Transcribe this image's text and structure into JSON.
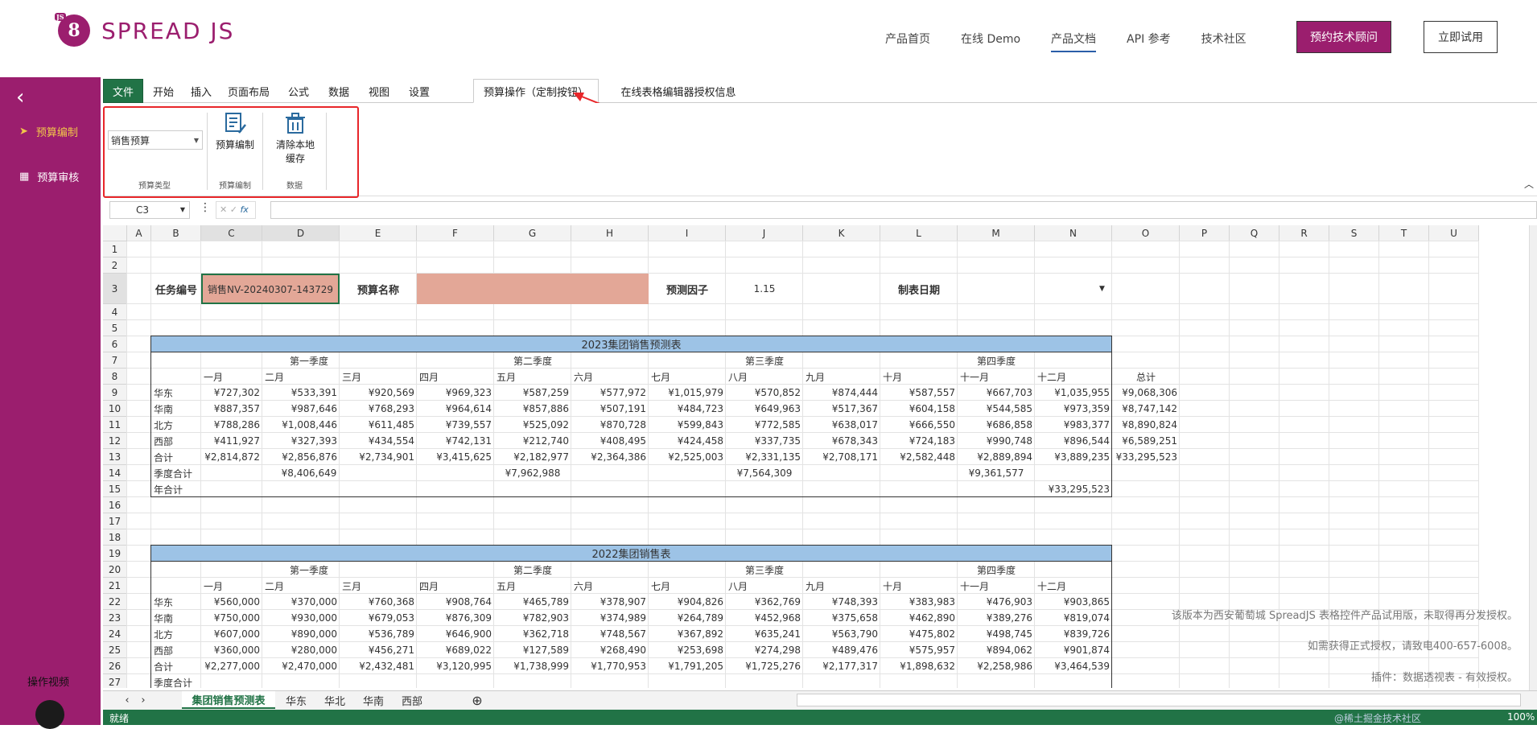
{
  "nav": {
    "logo_badge": "JS",
    "logo_letter": "8",
    "logo_text": "SPREAD JS",
    "links": [
      "产品首页",
      "在线 Demo",
      "产品文档",
      "API 参考",
      "技术社区"
    ],
    "active_link": "产品文档",
    "consult_button": "预约技术顾问",
    "try_button": "立即试用"
  },
  "sidebar": {
    "back_icon": "chevron-left-icon",
    "items": [
      {
        "label": "预算编制",
        "icon": "send-icon",
        "active": true
      },
      {
        "label": "预算审核",
        "icon": "grid-icon",
        "active": false
      }
    ],
    "video_label": "操作视频",
    "github_icon": "github-icon"
  },
  "ribbon": {
    "tabs": [
      "文件",
      "开始",
      "插入",
      "页面布局",
      "公式",
      "数据",
      "视图",
      "设置",
      "预算操作（定制按钮）",
      "在线表格编辑器授权信息"
    ],
    "active_tab": "预算操作（定制按钮）",
    "budget_type_value": "销售预算",
    "budget_type_group": "预算类型",
    "edit_button": "预算编制",
    "edit_group": "预算编制",
    "clear_button_line1": "清除本地",
    "clear_button_line2": "缓存",
    "clear_group": "数据"
  },
  "formula_bar": {
    "name_box": "C3",
    "fx_label": "fx",
    "fx_marks": "✕ ✓",
    "formula_value": ""
  },
  "columns": [
    "A",
    "B",
    "C",
    "D",
    "E",
    "F",
    "G",
    "H",
    "I",
    "J",
    "K",
    "L",
    "M",
    "N",
    "O",
    "P",
    "Q",
    "R",
    "S",
    "T",
    "U"
  ],
  "rows": [
    "1",
    "2",
    "3",
    "4",
    "5",
    "6",
    "7",
    "8",
    "9",
    "10",
    "11",
    "12",
    "13",
    "14",
    "15",
    "16",
    "17",
    "18",
    "19",
    "20",
    "21",
    "22",
    "23",
    "24",
    "25",
    "26",
    "27"
  ],
  "header_form": {
    "task_label": "任务编号",
    "task_value": "销售NV-20240307-143729",
    "name_label": "预算名称",
    "name_value": "",
    "factor_label": "预测因子",
    "factor_value": "1.15",
    "date_label": "制表日期",
    "date_value": ""
  },
  "table2023": {
    "title": "2023集团销售预测表",
    "quarters": [
      "第一季度",
      "第二季度",
      "第三季度",
      "第四季度"
    ],
    "months": [
      "一月",
      "二月",
      "三月",
      "四月",
      "五月",
      "六月",
      "七月",
      "八月",
      "九月",
      "十月",
      "十一月",
      "十二月"
    ],
    "total_header": "总计",
    "rows": [
      {
        "label": "华东",
        "values": [
          "¥727,302",
          "¥533,391",
          "¥920,569",
          "¥969,323",
          "¥587,259",
          "¥577,972",
          "¥1,015,979",
          "¥570,852",
          "¥874,444",
          "¥587,557",
          "¥667,703",
          "¥1,035,955"
        ],
        "total": "¥9,068,306"
      },
      {
        "label": "华南",
        "values": [
          "¥887,357",
          "¥987,646",
          "¥768,293",
          "¥964,614",
          "¥857,886",
          "¥507,191",
          "¥484,723",
          "¥649,963",
          "¥517,367",
          "¥604,158",
          "¥544,585",
          "¥973,359"
        ],
        "total": "¥8,747,142"
      },
      {
        "label": "北方",
        "values": [
          "¥788,286",
          "¥1,008,446",
          "¥611,485",
          "¥739,557",
          "¥525,092",
          "¥870,728",
          "¥599,843",
          "¥772,585",
          "¥638,017",
          "¥666,550",
          "¥686,858",
          "¥983,377"
        ],
        "total": "¥8,890,824"
      },
      {
        "label": "西部",
        "values": [
          "¥411,927",
          "¥327,393",
          "¥434,554",
          "¥742,131",
          "¥212,740",
          "¥408,495",
          "¥424,458",
          "¥337,735",
          "¥678,343",
          "¥724,183",
          "¥990,748",
          "¥896,544"
        ],
        "total": "¥6,589,251"
      },
      {
        "label": "合计",
        "values": [
          "¥2,814,872",
          "¥2,856,876",
          "¥2,734,901",
          "¥3,415,625",
          "¥2,182,977",
          "¥2,364,386",
          "¥2,525,003",
          "¥2,331,135",
          "¥2,708,171",
          "¥2,582,448",
          "¥2,889,894",
          "¥3,889,235"
        ],
        "total": "¥33,295,523"
      }
    ],
    "quarter_total_label": "季度合计",
    "quarter_totals": [
      "¥8,406,649",
      "¥7,962,988",
      "¥7,564,309",
      "¥9,361,577"
    ],
    "year_total_label": "年合计",
    "year_total": "¥33,295,523"
  },
  "table2022": {
    "title": "2022集团销售表",
    "quarters": [
      "第一季度",
      "第二季度",
      "第三季度",
      "第四季度"
    ],
    "months": [
      "一月",
      "二月",
      "三月",
      "四月",
      "五月",
      "六月",
      "七月",
      "八月",
      "九月",
      "十月",
      "十一月",
      "十二月"
    ],
    "rows": [
      {
        "label": "华东",
        "values": [
          "¥560,000",
          "¥370,000",
          "¥760,368",
          "¥908,764",
          "¥465,789",
          "¥378,907",
          "¥904,826",
          "¥362,769",
          "¥748,393",
          "¥383,983",
          "¥476,903",
          "¥903,865"
        ]
      },
      {
        "label": "华南",
        "values": [
          "¥750,000",
          "¥930,000",
          "¥679,053",
          "¥876,309",
          "¥782,903",
          "¥374,989",
          "¥264,789",
          "¥452,968",
          "¥375,658",
          "¥462,890",
          "¥389,276",
          "¥819,074"
        ]
      },
      {
        "label": "北方",
        "values": [
          "¥607,000",
          "¥890,000",
          "¥536,789",
          "¥646,900",
          "¥362,718",
          "¥748,567",
          "¥367,892",
          "¥635,241",
          "¥563,790",
          "¥475,802",
          "¥498,745",
          "¥839,726"
        ]
      },
      {
        "label": "西部",
        "values": [
          "¥360,000",
          "¥280,000",
          "¥456,271",
          "¥689,022",
          "¥127,589",
          "¥268,490",
          "¥253,698",
          "¥274,298",
          "¥489,476",
          "¥575,957",
          "¥894,062",
          "¥901,874"
        ]
      },
      {
        "label": "合计",
        "values": [
          "¥2,277,000",
          "¥2,470,000",
          "¥2,432,481",
          "¥3,120,995",
          "¥1,738,999",
          "¥1,770,953",
          "¥1,791,205",
          "¥1,725,276",
          "¥2,177,317",
          "¥1,898,632",
          "¥2,258,986",
          "¥3,464,539"
        ]
      }
    ],
    "quarter_total_label": "季度合计"
  },
  "watermark": [
    "该版本为西安葡萄城 SpreadJS 表格控件产品试用版，未取得再分发授权。",
    "如需获得正式授权，请致电400-657-6008。",
    "插件：数据透视表 - 有效授权。"
  ],
  "sheet_tabs": [
    "集团销售预测表",
    "华东",
    "华北",
    "华南",
    "西部"
  ],
  "active_sheet": "集团销售预测表",
  "status": "就绪",
  "zoom": "100%",
  "corner_watermark": "@稀土掘金技术社区",
  "colors": {
    "brand": "#9b1e6e",
    "excel_green": "#217346",
    "header_blue": "#9dc3e6",
    "salmon": "#e3a797"
  }
}
